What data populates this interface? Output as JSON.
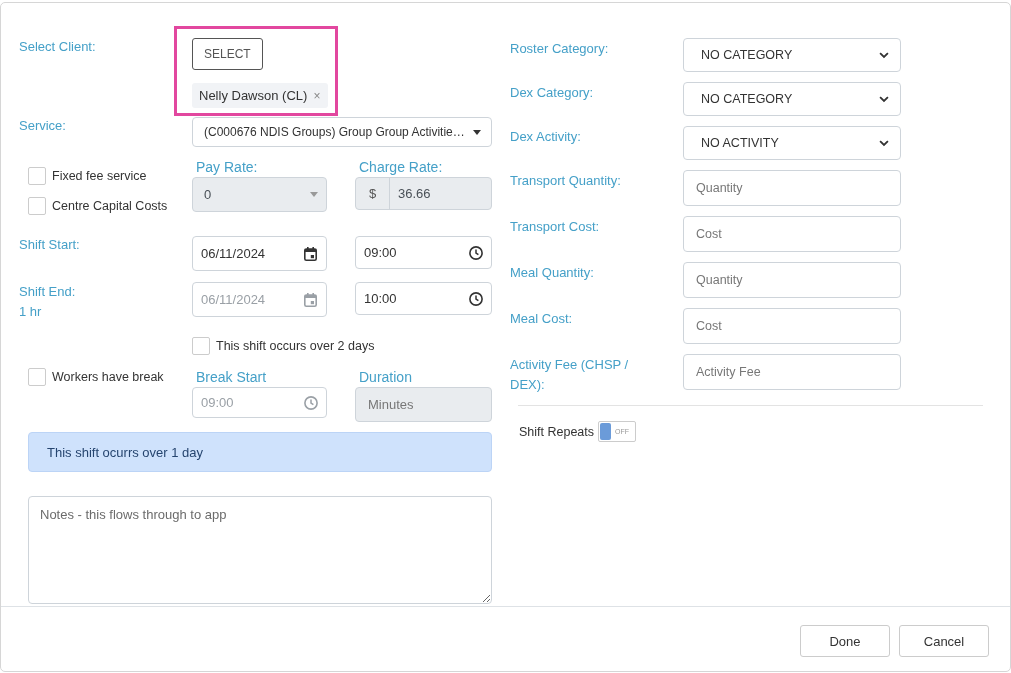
{
  "client": {
    "label": "Select Client:",
    "highlighted": true,
    "button": "SELECT",
    "chips": [
      {
        "text": "Nelly Dawson (CL)",
        "remove": "×"
      }
    ]
  },
  "service": {
    "label": "Service:",
    "value": "(C000676 NDIS Groups) Group Group Activitie…"
  },
  "options": [
    {
      "label": "Fixed fee service",
      "checked": false
    },
    {
      "label": "Centre Capital Costs",
      "checked": false
    }
  ],
  "pay_rate": {
    "label": "Pay Rate:",
    "value": "0",
    "disabled": true
  },
  "charge_rate": {
    "label": "Charge Rate:",
    "prefix": "$",
    "value": "36.66",
    "disabled": true
  },
  "shift_start": {
    "label": "Shift Start:",
    "date": {
      "value": "06/11/2024",
      "disabled": false
    },
    "time": {
      "value": "09:00",
      "disabled": false
    }
  },
  "shift_end": {
    "label": "Shift End:",
    "length": "1 hr",
    "date": {
      "value": "06/11/2024",
      "disabled": true
    },
    "time": {
      "value": "10:00",
      "disabled": false
    }
  },
  "multi_day": {
    "label": "This shift occurs over 2 days",
    "checked": false
  },
  "worker_break": {
    "label": "Workers have break",
    "checked": false,
    "start_label": "Break Start",
    "start": {
      "value": "09:00",
      "disabled": true
    },
    "duration_label": "Duration",
    "duration": {
      "placeholder": "Minutes",
      "disabled": true
    }
  },
  "alert": "This shift ocurrs over 1 day",
  "notes": {
    "placeholder": "Notes - this flows through to app"
  },
  "right_fields": [
    {
      "kind": "select",
      "label": "Roster Category:",
      "value": "NO CATEGORY"
    },
    {
      "kind": "select",
      "label": "Dex Category:",
      "value": "NO CATEGORY"
    },
    {
      "kind": "select",
      "label": "Dex Activity:",
      "value": "NO ACTIVITY"
    },
    {
      "kind": "input",
      "label": "Transport Quantity:",
      "placeholder": "Quantity"
    },
    {
      "kind": "input",
      "label": "Transport Cost:",
      "placeholder": "Cost"
    },
    {
      "kind": "input",
      "label": "Meal Quantity:",
      "placeholder": "Quantity"
    },
    {
      "kind": "input",
      "label": "Meal Cost:",
      "placeholder": "Cost"
    },
    {
      "kind": "input",
      "label": "Activity Fee (CHSP / DEX):",
      "placeholder": "Activity Fee"
    }
  ],
  "shift_repeats": {
    "label": "Shift Repeats",
    "on": false,
    "state_text": "OFF"
  },
  "footer_buttons": [
    "Done",
    "Cancel"
  ]
}
